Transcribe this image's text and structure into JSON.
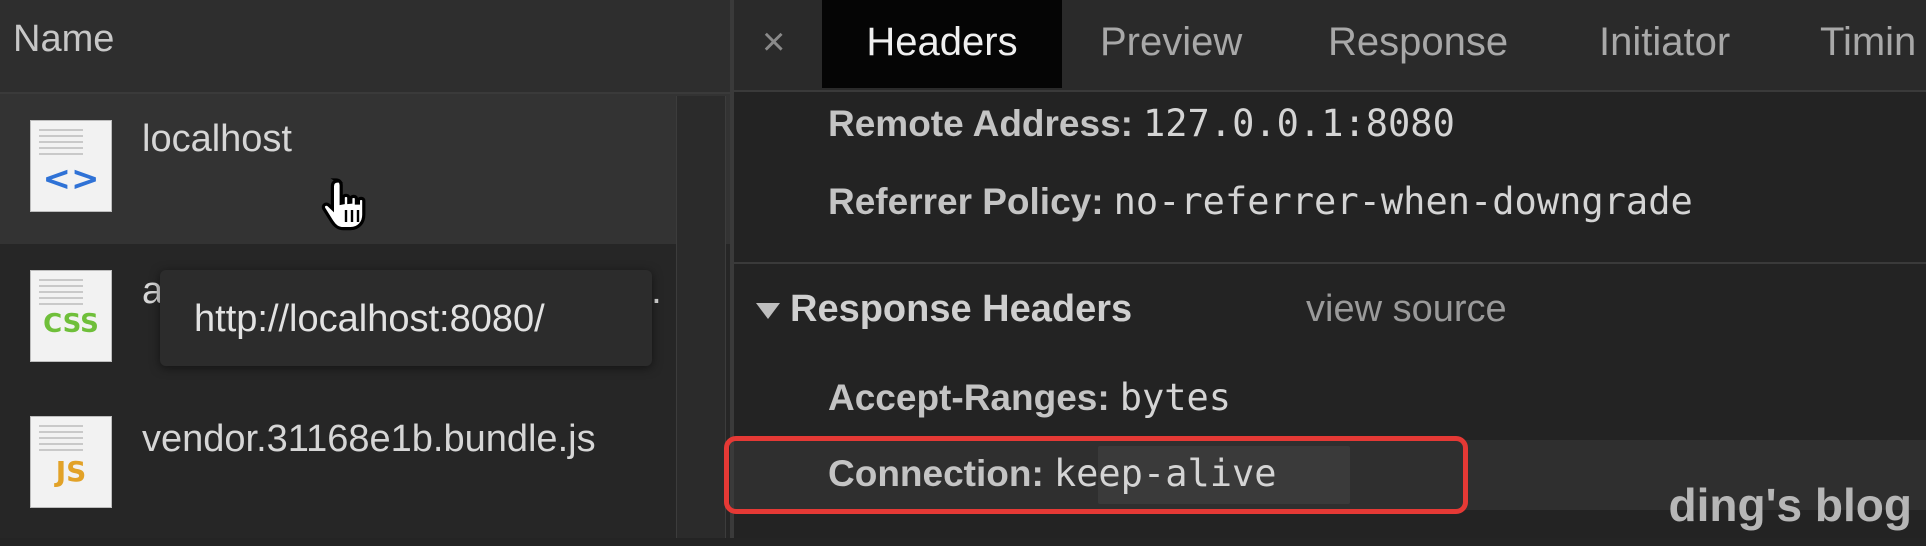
{
  "name_column": {
    "header": "Name"
  },
  "requests": [
    {
      "name": "localhost",
      "icon": "html-document-icon",
      "badge": "<>",
      "badge_color": "#2f72d6"
    },
    {
      "name": "a",
      "name_tail": "e.",
      "icon": "css-document-icon",
      "badge": "CSS",
      "badge_color": "#6fbf3a"
    },
    {
      "name": "vendor.31168e1b.bundle.js",
      "icon": "js-document-icon",
      "badge": "JS",
      "badge_color": "#e2a228"
    }
  ],
  "tooltip": {
    "text": "http://localhost:8080/"
  },
  "detail_tabs": {
    "close": "×",
    "items": [
      "Headers",
      "Preview",
      "Response",
      "Initiator",
      "Timin"
    ],
    "active": "Headers"
  },
  "general": {
    "remote_address_key": "Remote Address:",
    "remote_address_val": "127.0.0.1:8080",
    "referrer_policy_key": "Referrer Policy:",
    "referrer_policy_val": "no-referrer-when-downgrade"
  },
  "response_headers": {
    "title": "Response Headers",
    "view_source": "view source",
    "accept_ranges_key": "Accept-Ranges:",
    "accept_ranges_val": "bytes",
    "connection_key": "Connection:",
    "connection_val": "keep-alive"
  },
  "annotation": {
    "highlight_color": "#e53935"
  },
  "watermark": "ding's blog"
}
